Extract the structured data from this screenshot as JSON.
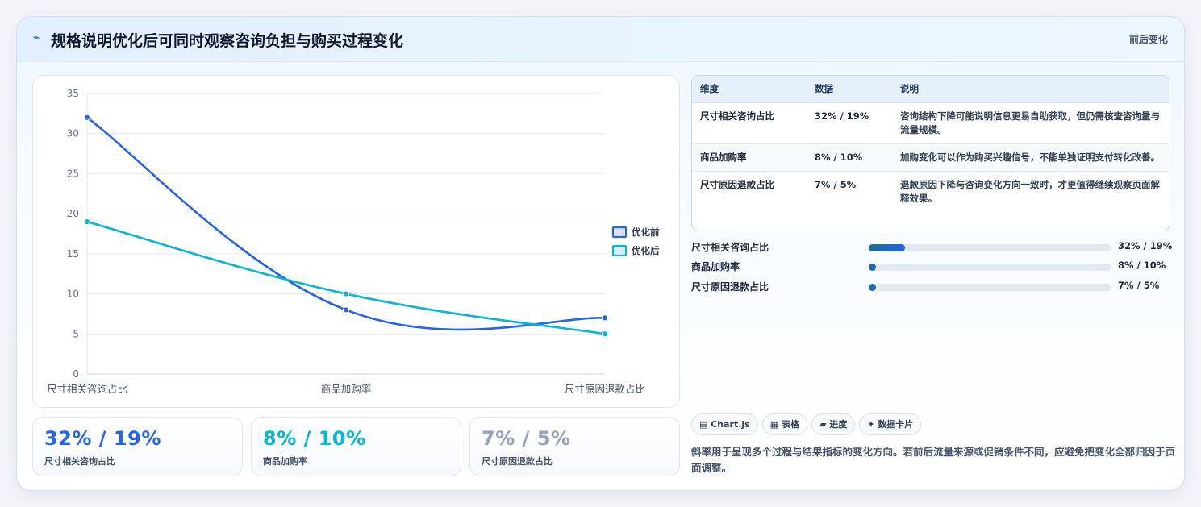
{
  "header": {
    "title": "规格说明优化后可同时观察咨询负担与购买过程变化",
    "badge": "前后变化"
  },
  "chart_data": {
    "type": "line",
    "categories": [
      "尺寸相关咨询占比",
      "商品加购率",
      "尺寸原因退款占比"
    ],
    "series": [
      {
        "name": "优化前",
        "values": [
          32,
          8,
          7
        ],
        "color": "#2563eb"
      },
      {
        "name": "优化后",
        "values": [
          19,
          10,
          5
        ],
        "color": "#06b6d4"
      }
    ],
    "ylim": [
      0,
      35
    ],
    "yticks": [
      0,
      5,
      10,
      15,
      20,
      25,
      30,
      35
    ],
    "grid": true,
    "legend": "right"
  },
  "stats": [
    {
      "value": "32% / 19%",
      "label": "尺寸相关咨询占比",
      "color": "#2563eb"
    },
    {
      "value": "8% / 10%",
      "label": "商品加购率",
      "color": "#06b6d4"
    },
    {
      "value": "7% / 5%",
      "label": "尺寸原因退款占比",
      "color": "#94a3b8"
    }
  ],
  "table": {
    "headers": [
      "维度",
      "数据",
      "说明"
    ],
    "rows": [
      {
        "dim": "尺寸相关咨询占比",
        "data": "32% / 19%",
        "note": "咨询结构下降可能说明信息更易自助获取，但仍需核查咨询量与流量规模。"
      },
      {
        "dim": "商品加购率",
        "data": "8% / 10%",
        "note": "加购变化可以作为购买兴趣信号，不能单独证明支付转化改善。"
      },
      {
        "dim": "尺寸原因退款占比",
        "data": "7% / 5%",
        "note": "退款原因下降与咨询变化方向一致时，才更值得继续观察页面解释效果。"
      }
    ]
  },
  "progress": [
    {
      "label": "尺寸相关咨询占比",
      "fraction": 0.15,
      "value": "32% / 19%"
    },
    {
      "label": "商品加购率",
      "fraction": 0.03,
      "value": "8% / 10%"
    },
    {
      "label": "尺寸原因退款占比",
      "fraction": 0.03,
      "value": "7% / 5%"
    }
  ],
  "tags": [
    "▤ Chart.js",
    "▦ 表格",
    "▰ 进度",
    "✦ 数据卡片"
  ],
  "description": "斜率用于呈现多个过程与结果指标的变化方向。若前后流量来源或促销条件不同，应避免把变化全部归因于页面调整。"
}
